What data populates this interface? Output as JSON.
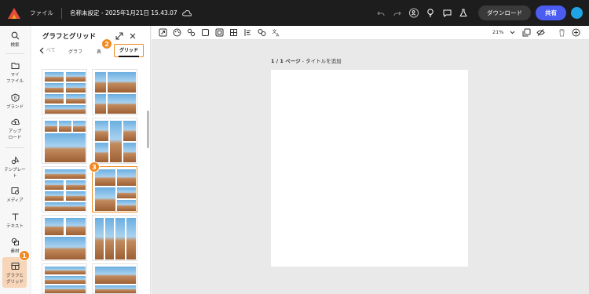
{
  "topbar": {
    "file_label": "ファイル",
    "doc_title": "名称未設定 - 2025年1月21日 15.43.07",
    "download_label": "ダウンロード",
    "share_label": "共有",
    "icons": [
      "undo-icon",
      "redo-icon",
      "add-user-icon",
      "lightbulb-icon",
      "comment-icon",
      "flask-icon"
    ]
  },
  "rail": {
    "items": [
      {
        "label": "検索",
        "icon": "search-icon"
      },
      {
        "label": "マイ\nファイル",
        "icon": "folder-icon"
      },
      {
        "label": "ブランド",
        "icon": "brand-icon"
      },
      {
        "label": "アップ\nロード",
        "icon": "upload-icon"
      },
      {
        "label": "テンプレー\nト",
        "icon": "template-icon"
      },
      {
        "label": "メディア",
        "icon": "media-icon"
      },
      {
        "label": "テキスト",
        "icon": "text-icon"
      },
      {
        "label": "素材",
        "icon": "elements-icon"
      },
      {
        "label": "グラフと\nグリッド",
        "icon": "grid-chart-icon"
      }
    ]
  },
  "panel": {
    "title": "グラフとグリッド",
    "tabs": {
      "back": "べて",
      "graph": "グラフ",
      "table": "表",
      "grid": "グリッド"
    }
  },
  "badges": [
    "1",
    "2",
    "3"
  ],
  "toolbar": {
    "zoom": "21%"
  },
  "canvas": {
    "page_label_bold": "1 / 1 ページ",
    "page_label_rest": " - タイトルを追加"
  },
  "colors": {
    "accent": "#f08a24",
    "share": "#4b5cf0",
    "topbar": "#1d1d1d"
  }
}
